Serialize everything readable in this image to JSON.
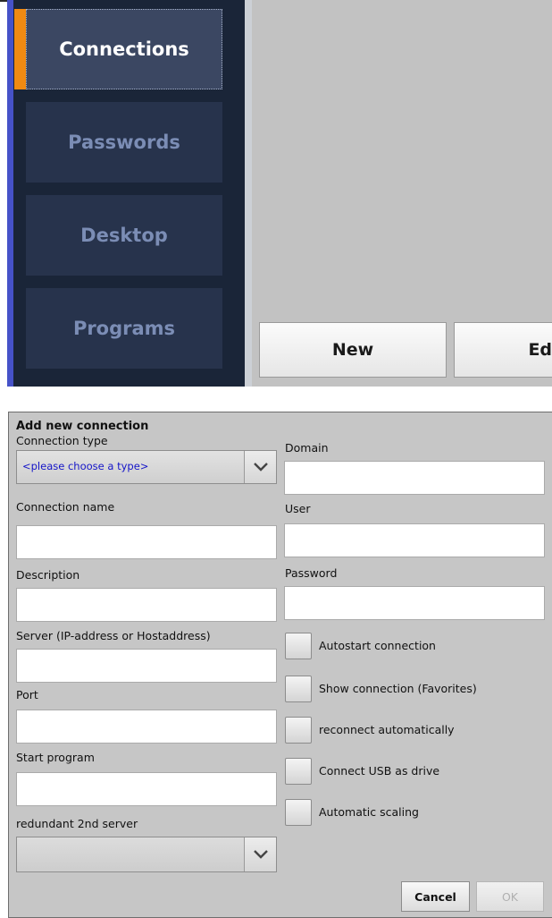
{
  "sidebar": {
    "items": [
      {
        "label": "Connections",
        "active": true
      },
      {
        "label": "Passwords",
        "active": false
      },
      {
        "label": "Desktop",
        "active": false
      },
      {
        "label": "Programs",
        "active": false
      }
    ]
  },
  "toolbar": {
    "new_label": "New",
    "edit_label": "Edi"
  },
  "dialog": {
    "title": "Add new connection",
    "connection_type": {
      "label": "Connection type",
      "value": "<please choose a type>"
    },
    "connection_name": {
      "label": "Connection name",
      "value": ""
    },
    "description": {
      "label": "Description",
      "value": ""
    },
    "server": {
      "label": "Server (IP-address or Hostaddress)",
      "value": ""
    },
    "port": {
      "label": "Port",
      "value": ""
    },
    "start_program": {
      "label": "Start program",
      "value": ""
    },
    "redundant_server": {
      "label": "redundant 2nd server",
      "value": ""
    },
    "domain": {
      "label": "Domain",
      "value": ""
    },
    "user": {
      "label": "User",
      "value": ""
    },
    "password": {
      "label": "Password",
      "value": ""
    },
    "checkboxes": [
      {
        "label": "Autostart connection",
        "checked": false
      },
      {
        "label": "Show connection (Favorites)",
        "checked": false
      },
      {
        "label": "reconnect automatically",
        "checked": false
      },
      {
        "label": "Connect USB as drive",
        "checked": false
      },
      {
        "label": "Automatic scaling",
        "checked": false
      }
    ],
    "cancel_label": "Cancel",
    "ok_label": "OK"
  },
  "colors": {
    "accent_indicator": "#f08a12",
    "sidebar_bg": "#1a2538",
    "select_text": "#1515c8"
  },
  "icons": [
    "chevron-down-icon"
  ]
}
